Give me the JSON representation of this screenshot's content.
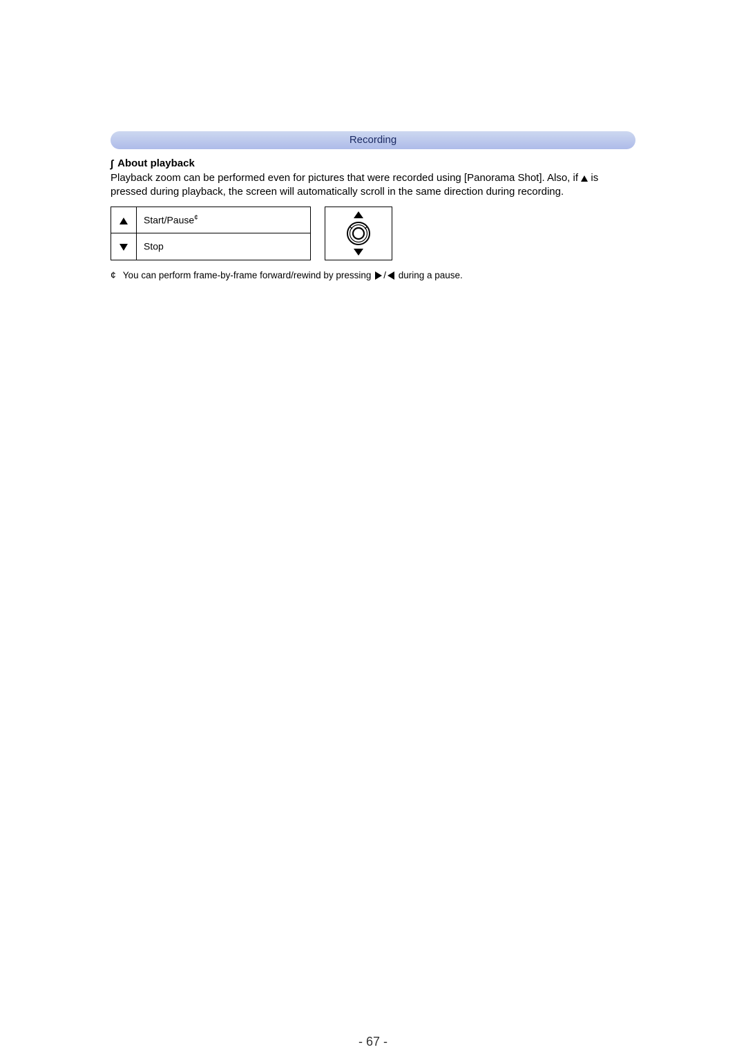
{
  "header": {
    "title": "Recording"
  },
  "section": {
    "heading": "About playback",
    "paragraph_part1": "Playback zoom can be performed even for pictures that were recorded using [Panorama Shot]. Also, if ",
    "paragraph_part2": " is pressed during playback, the screen will automatically scroll in the same direction during recording."
  },
  "controls": {
    "rows": [
      {
        "icon": "up",
        "label": "Start/Pause",
        "marker": "¢"
      },
      {
        "icon": "down",
        "label": "Stop",
        "marker": ""
      }
    ]
  },
  "footnote": {
    "marker": "¢",
    "text_part1": "You can perform frame-by-frame forward/rewind by pressing ",
    "text_mid": "/",
    "text_part2": " during a pause."
  },
  "page_number": "- 67 -"
}
